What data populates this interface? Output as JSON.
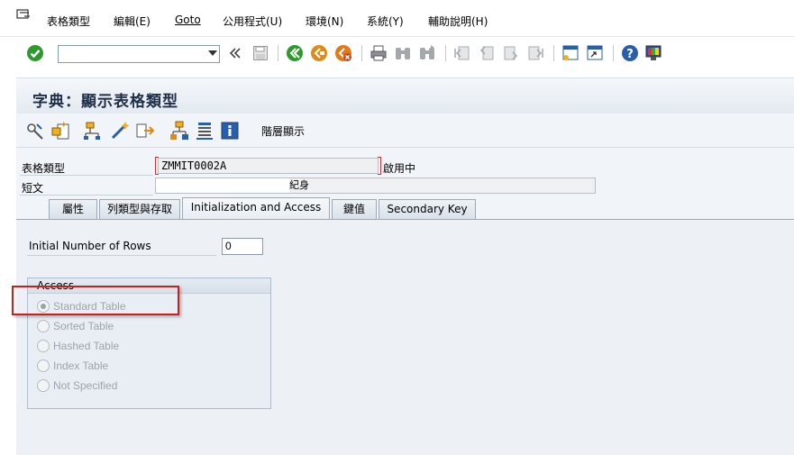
{
  "menubar": {
    "items": [
      {
        "label": "表格類型"
      },
      {
        "label": "編輯(E)"
      },
      {
        "label": "Goto"
      },
      {
        "label": "公用程式(U)"
      },
      {
        "label": "環境(N)"
      },
      {
        "label": "系統(Y)"
      },
      {
        "label": "輔助說明(H)"
      }
    ]
  },
  "toolbar": {
    "command_field_value": "",
    "icons": [
      "enter-check-icon",
      "history-chevron-icon",
      "save-icon",
      "back-icon",
      "exit-icon",
      "cancel-icon",
      "print-icon",
      "find-icon",
      "find-next-icon",
      "first-page-icon",
      "previous-page-icon",
      "next-page-icon",
      "last-page-icon",
      "create-session-icon",
      "shortcut-icon",
      "help-icon",
      "customize-layout-icon"
    ],
    "colors": {
      "green": "#2e9a2e",
      "orange": "#e08a1a",
      "red": "#d0401c",
      "blue": "#2a5ea8"
    }
  },
  "page": {
    "title": "字典：顯示表格類型"
  },
  "app_toolbar": {
    "hierarchy_label": "階層顯示",
    "icons": [
      "other-object-icon",
      "display-change-icon",
      "where-used-icon",
      "activate-icon",
      "transport-icon",
      "object-list-icon",
      "documentation-icon",
      "info-icon"
    ]
  },
  "form": {
    "table_type_label": "表格類型",
    "table_type_value": "ZMMIT0002A",
    "status_text": "啟用中",
    "short_text_label": "短文",
    "short_text_value": "紀身"
  },
  "tabs": [
    {
      "label": "屬性"
    },
    {
      "label": "列類型與存取"
    },
    {
      "label": "Initialization and Access",
      "active": true
    },
    {
      "label": "鍵值"
    },
    {
      "label": "Secondary Key"
    }
  ],
  "init": {
    "label": "Initial Number of Rows",
    "value": "0"
  },
  "access": {
    "title": "Access",
    "options": [
      {
        "label": "Standard Table",
        "selected": true
      },
      {
        "label": "Sorted Table",
        "selected": false
      },
      {
        "label": "Hashed Table",
        "selected": false
      },
      {
        "label": "Index Table",
        "selected": false
      },
      {
        "label": "Not Specified",
        "selected": false
      }
    ],
    "highlight_color": "#d21c1c"
  }
}
